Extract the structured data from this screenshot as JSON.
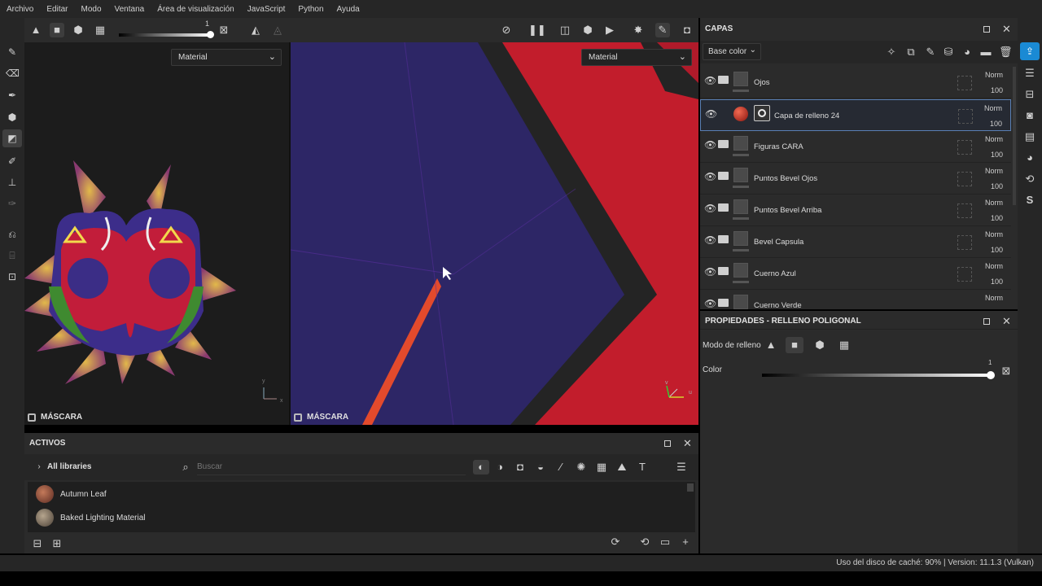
{
  "menubar": {
    "items": [
      "Archivo",
      "Editar",
      "Modo",
      "Ventana",
      "Área de visualización",
      "JavaScript",
      "Python",
      "Ayuda"
    ]
  },
  "toolbar": {
    "slider_value": "1"
  },
  "viewport3d": {
    "material_select": "Material",
    "label": "MÁSCARA",
    "axis_x": "x",
    "axis_y": "y"
  },
  "viewport2d": {
    "material_select": "Material",
    "label": "MÁSCARA",
    "axis_u": "u",
    "axis_v": "v"
  },
  "assets": {
    "title": "ACTIVOS",
    "library": "All libraries",
    "search_placeholder": "Buscar",
    "items": [
      {
        "name": "Autumn Leaf",
        "thumb_color": "#8a5a4a"
      },
      {
        "name": "Baked Lighting Material",
        "thumb_color": "#7a6a5a"
      }
    ]
  },
  "layers": {
    "title": "CAPAS",
    "channel_select": "Base color",
    "rows": [
      {
        "name": "Ojos",
        "blend": "Norm",
        "opacity": "100",
        "type": "folder-open",
        "selected": false
      },
      {
        "name": "Capa de relleno 24",
        "blend": "Norm",
        "opacity": "100",
        "type": "fill",
        "selected": true
      },
      {
        "name": "Figuras CARA",
        "blend": "Norm",
        "opacity": "100",
        "type": "folder",
        "selected": false
      },
      {
        "name": "Puntos Bevel Ojos",
        "blend": "Norm",
        "opacity": "100",
        "type": "folder",
        "selected": false
      },
      {
        "name": "Puntos Bevel Arriba",
        "blend": "Norm",
        "opacity": "100",
        "type": "folder",
        "selected": false
      },
      {
        "name": "Bevel Capsula",
        "blend": "Norm",
        "opacity": "100",
        "type": "folder",
        "selected": false
      },
      {
        "name": "Cuerno Azul",
        "blend": "Norm",
        "opacity": "100",
        "type": "folder",
        "selected": false
      },
      {
        "name": "Cuerno Verde",
        "blend": "Norm",
        "opacity": "",
        "type": "folder",
        "selected": false
      }
    ]
  },
  "properties": {
    "title": "PROPIEDADES - RELLENO POLIGONAL",
    "fill_mode_label": "Modo de relleno",
    "color_label": "Color",
    "color_value": "1"
  },
  "status": {
    "text": "Uso del disco de caché:   90% | Version: 11.1.3 (Vulkan)"
  },
  "colors": {
    "accent": "#1a8ad4",
    "selection_border": "#5a7fb4"
  }
}
